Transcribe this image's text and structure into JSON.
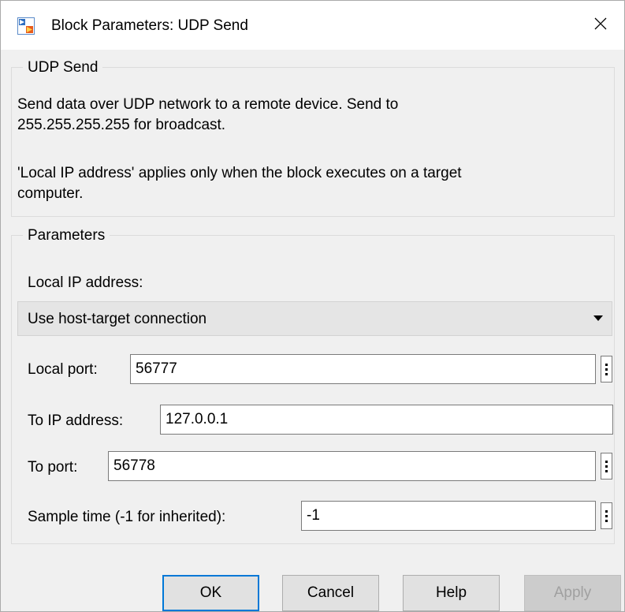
{
  "window": {
    "title": "Block Parameters: UDP Send",
    "icon": "simulink-block-icon",
    "close_icon": "close-icon"
  },
  "block_group": {
    "legend": "UDP Send",
    "description_line1": "Send data over UDP network to a remote device. Send to",
    "description_line2": "255.255.255.255 for broadcast.",
    "note_line1": "'Local IP address' applies only when the block executes on a target",
    "note_line2": "computer."
  },
  "params_group": {
    "legend": "Parameters",
    "local_ip": {
      "label": "Local IP address:",
      "selected": "Use host-target connection"
    },
    "local_port": {
      "label": "Local port:",
      "value": "56777"
    },
    "to_ip": {
      "label": "To IP address:",
      "value": "127.0.0.1"
    },
    "to_port": {
      "label": "To port:",
      "value": "56778"
    },
    "sample_time": {
      "label": "Sample time (-1 for inherited):",
      "value": "-1"
    }
  },
  "buttons": {
    "ok": "OK",
    "cancel": "Cancel",
    "help": "Help",
    "apply": "Apply"
  },
  "colors": {
    "accent": "#0078d7",
    "dialog_bg": "#f0f0f0"
  }
}
